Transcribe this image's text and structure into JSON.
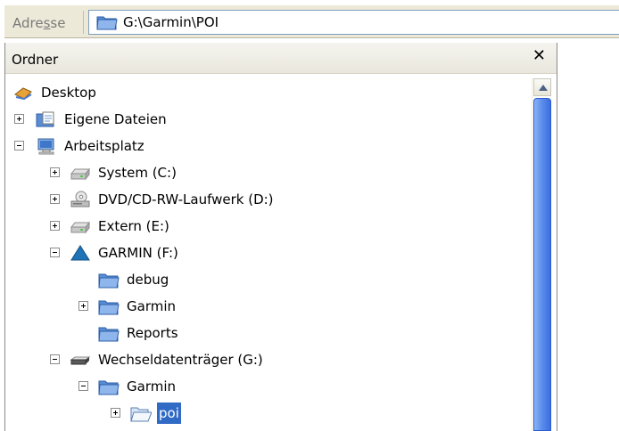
{
  "address": {
    "label_prefix": "Adre",
    "label_underlined": "s",
    "label_suffix": "se",
    "value": "G:\\Garmin\\POI"
  },
  "pane": {
    "title": "Ordner",
    "close_glyph": "✕"
  },
  "tree": [
    {
      "label": "Desktop",
      "icon": "desktop-icon",
      "expander": "none",
      "level": 0
    },
    {
      "label": "Eigene Dateien",
      "icon": "my-documents-icon",
      "expander": "plus",
      "level": 1
    },
    {
      "label": "Arbeitsplatz",
      "icon": "my-computer-icon",
      "expander": "minus",
      "level": 1
    },
    {
      "label": "System (C:)",
      "icon": "hard-drive-icon",
      "expander": "plus",
      "level": 2
    },
    {
      "label": "DVD/CD-RW-Laufwerk (D:)",
      "icon": "cd-drive-icon",
      "expander": "plus",
      "level": 2
    },
    {
      "label": "Extern (E:)",
      "icon": "hard-drive-icon",
      "expander": "plus",
      "level": 2
    },
    {
      "label": "GARMIN (F:)",
      "icon": "garmin-triangle-icon",
      "expander": "minus",
      "level": 2
    },
    {
      "label": "debug",
      "icon": "folder-icon",
      "expander": "none",
      "level": 3
    },
    {
      "label": "Garmin",
      "icon": "folder-icon",
      "expander": "plus",
      "level": 3
    },
    {
      "label": "Reports",
      "icon": "folder-icon",
      "expander": "none",
      "level": 3
    },
    {
      "label": "Wechseldatenträger (G:)",
      "icon": "removable-drive-icon",
      "expander": "minus",
      "level": 2
    },
    {
      "label": "Garmin",
      "icon": "folder-icon",
      "expander": "minus",
      "level": 3
    },
    {
      "label": "poi",
      "icon": "open-folder-icon",
      "expander": "plus",
      "level": 4,
      "selected": true
    }
  ],
  "colors": {
    "selection": "#316ac5",
    "scroll_thumb": "#5d8fec",
    "toolbar": "#ece9d8"
  }
}
